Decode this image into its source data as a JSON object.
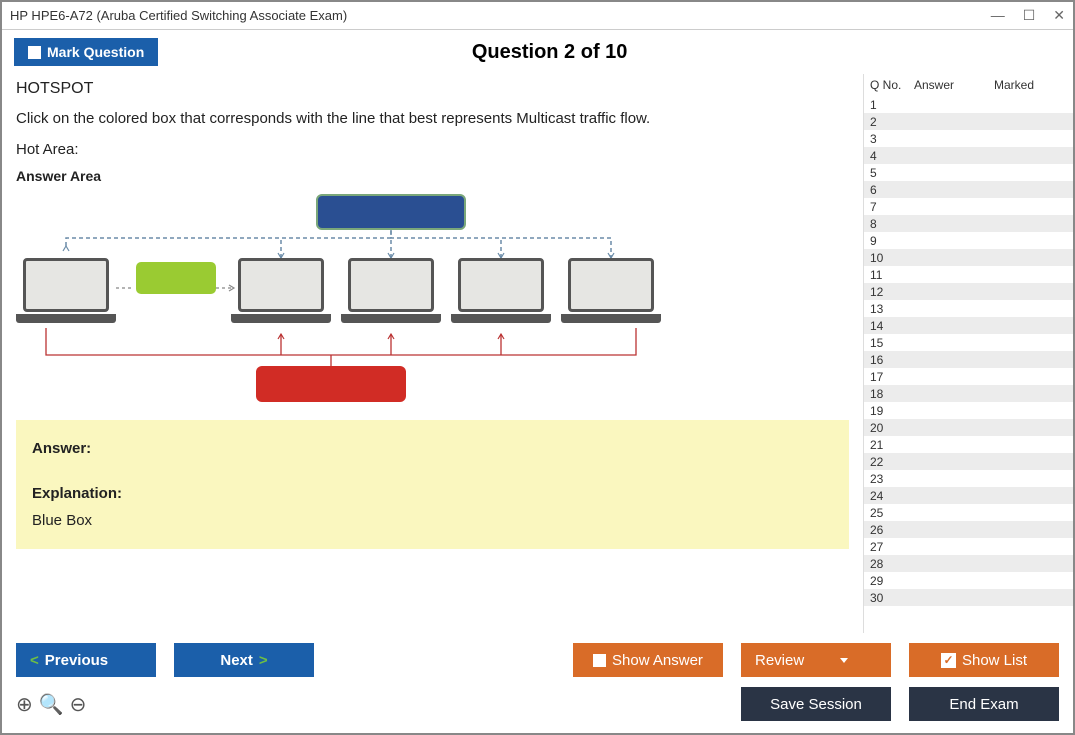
{
  "window_title": "HP HPE6-A72 (Aruba Certified Switching Associate Exam)",
  "mark_question": "Mark Question",
  "question_title": "Question 2 of 10",
  "hotspot_label": "HOTSPOT",
  "instruction": "Click on the colored box that corresponds with the line that best represents Multicast traffic flow.",
  "hot_area_label": "Hot Area:",
  "answer_area_label": "Answer Area",
  "answer_label": "Answer:",
  "explanation_label": "Explanation:",
  "explanation_text": "Blue Box",
  "sidebar": {
    "col_qno": "Q No.",
    "col_answer": "Answer",
    "col_marked": "Marked",
    "rows": [
      1,
      2,
      3,
      4,
      5,
      6,
      7,
      8,
      9,
      10,
      11,
      12,
      13,
      14,
      15,
      16,
      17,
      18,
      19,
      20,
      21,
      22,
      23,
      24,
      25,
      26,
      27,
      28,
      29,
      30
    ],
    "active": 2
  },
  "buttons": {
    "previous": "Previous",
    "next": "Next",
    "show_answer": "Show Answer",
    "review": "Review",
    "show_list": "Show List",
    "save_session": "Save Session",
    "end_exam": "End Exam"
  }
}
